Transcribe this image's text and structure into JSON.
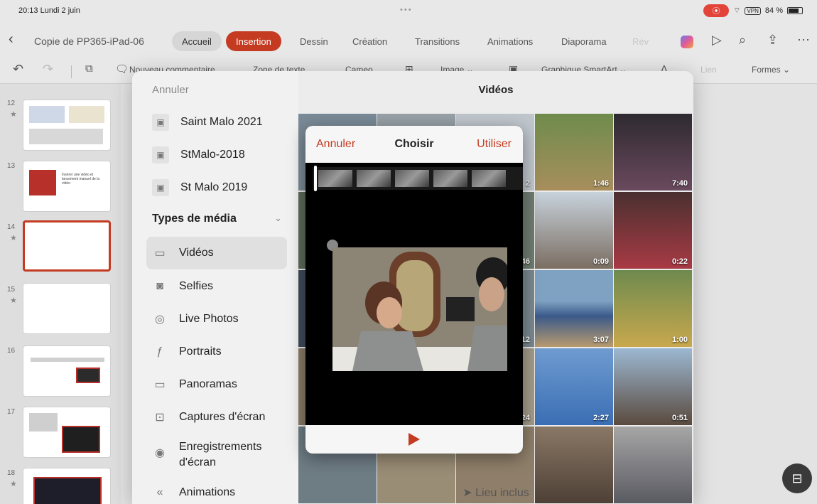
{
  "status": {
    "time": "20:13  Lundi 2 juin",
    "dots": "•••",
    "battery": "84 %",
    "vpn": "VPN"
  },
  "ribbon": {
    "doc_title": "Copie de PP365-iPad-06",
    "tabs": [
      "Accueil",
      "Insertion",
      "Dessin",
      "Création",
      "Transitions",
      "Animations",
      "Diaporama",
      "Rév"
    ],
    "active_tab": "Insertion"
  },
  "toolbar": {
    "undo_icon": "undo-icon",
    "new_comment": "Nouveau commentaire",
    "text_box": "Zone de texte",
    "cameo": "Cameo",
    "image": "Image ⌄",
    "smartart": "Graphique SmartArt ⌄",
    "link": "Lien",
    "shapes": "Formes ⌄"
  },
  "slides": [
    {
      "num": "12",
      "starred": true
    },
    {
      "num": "13",
      "starred": false,
      "text": "Insérer une vidéo et lancement manuel de la vidéo"
    },
    {
      "num": "14",
      "starred": true,
      "selected": true
    },
    {
      "num": "15",
      "starred": true
    },
    {
      "num": "16",
      "starred": false
    },
    {
      "num": "17",
      "starred": false
    },
    {
      "num": "18",
      "starred": true
    }
  ],
  "picker": {
    "cancel": "Annuler",
    "title": "Vidéos",
    "albums": [
      "Saint Malo 2021",
      "StMalo-2018",
      "St Malo 2019"
    ],
    "media_types_header": "Types de média",
    "media_types": [
      {
        "label": "Vidéos",
        "icon": "video-icon",
        "active": true
      },
      {
        "label": "Selfies",
        "icon": "selfie-icon"
      },
      {
        "label": "Live Photos",
        "icon": "live-photo-icon"
      },
      {
        "label": "Portraits",
        "icon": "portrait-icon"
      },
      {
        "label": "Panoramas",
        "icon": "panorama-icon"
      },
      {
        "label": "Captures d'écran",
        "icon": "screenshot-icon"
      },
      {
        "label": "Enregistrements d'écran",
        "icon": "screen-recording-icon"
      },
      {
        "label": "Animations",
        "icon": "animation-icon"
      }
    ],
    "durations": [
      "1:46",
      "7:40",
      "0:09",
      "0:22",
      "3:07",
      "1:00",
      "2:27",
      "0:51"
    ],
    "partial_durations": [
      "2",
      "46",
      "12",
      "24"
    ],
    "location": "Lieu inclus"
  },
  "preview": {
    "cancel": "Annuler",
    "title": "Choisir",
    "use": "Utiliser"
  },
  "colors": {
    "accent": "#c43b22"
  }
}
